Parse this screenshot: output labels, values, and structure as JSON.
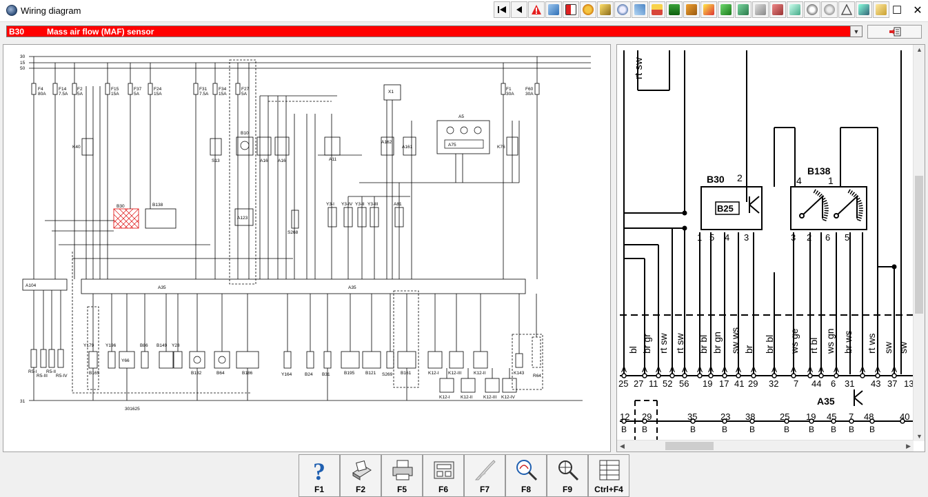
{
  "window": {
    "title": "Wiring diagram",
    "controls": [
      "☐",
      "✕"
    ]
  },
  "toolbar": {
    "icons": [
      "first-page-icon",
      "prev-page-icon",
      "warning-icon",
      "diagram-icon",
      "flag-icon",
      "gear-icon",
      "engine-icon",
      "clock-icon",
      "tools-icon",
      "battery-icon",
      "fuel-icon",
      "car-icon",
      "lamp-icon",
      "brake-icon",
      "circuit-icon",
      "info-icon",
      "settings-icon",
      "book-icon",
      "gauge-icon",
      "bulb-icon",
      "triangle-icon",
      "chip-icon",
      "note-icon"
    ]
  },
  "component_selector": {
    "code": "B30",
    "name": "Mass air flow (MAF) sensor"
  },
  "left_diagram": {
    "bus_labels": [
      "30",
      "15",
      "50",
      "31"
    ],
    "fuses": [
      "F4",
      "F14",
      "F2",
      "F15",
      "F37",
      "F24",
      "F31",
      "F34",
      "F27",
      "F1",
      "F60"
    ],
    "fuse_ratings": [
      "80A",
      "7.5A",
      "5A",
      "15A",
      "5A",
      "15A",
      "7.5A",
      "15A",
      "5A",
      "30A",
      "30A"
    ],
    "components_top": [
      "K40",
      "S13",
      "B10",
      "A16",
      "A16",
      "A11",
      "X1",
      "A162",
      "A161",
      "A5",
      "A75",
      "K76"
    ],
    "components_mid": [
      "B30",
      "B138",
      "A123",
      "S268",
      "Y3-I",
      "Y3-IV",
      "Y3-II",
      "Y3-III",
      "A81"
    ],
    "ecu_labels": [
      "A104",
      "A35",
      "A35"
    ],
    "components_bottom": [
      "R5-I",
      "R5-III",
      "R5-II",
      "R5-IV",
      "Y179",
      "B165",
      "Y196",
      "Y66",
      "B86",
      "B149",
      "Y28",
      "B132",
      "B64",
      "B186",
      "Y164",
      "B24",
      "B31",
      "B195",
      "B121",
      "S269",
      "B161",
      "K12-I",
      "K12-III",
      "K12-II",
      "K143",
      "R64"
    ],
    "relay_boxes": [
      "K12-I",
      "K12-II",
      "K12-III",
      "K12-IV"
    ],
    "drawing_number": "301625"
  },
  "right_diagram": {
    "wire_top": "rt sw",
    "b30": {
      "label": "B30",
      "inner": "B25",
      "pin_top": "2",
      "pins": [
        "1",
        "5",
        "4",
        "3"
      ]
    },
    "b138": {
      "label": "B138",
      "pin_top_left": "4",
      "pin_top_right": "1",
      "pins": [
        "3",
        "2",
        "6",
        "5"
      ]
    },
    "wire_colors": [
      "bl",
      "br gr",
      "rt sw",
      "rt sw",
      "br bl",
      "br gn",
      "sw ws",
      "br",
      "br bl",
      "ws ge",
      "rt bl",
      "ws gn",
      "br ws",
      "rt ws",
      "sw",
      "sw"
    ],
    "pin_letter": "A",
    "ecu_pins": [
      "25",
      "27",
      "11",
      "52",
      "56",
      "19",
      "17",
      "41",
      "29",
      "32",
      "7",
      "44",
      "6",
      "31",
      "43",
      "37",
      "13"
    ],
    "ecu_label": "A35",
    "lower_pins": [
      "12",
      "29",
      "35",
      "23",
      "38",
      "25",
      "19",
      "45",
      "7",
      "48",
      "40"
    ],
    "lower_letter": "B"
  },
  "function_keys": [
    {
      "label": "F1",
      "icon": "help-icon"
    },
    {
      "label": "F2",
      "icon": "print-preview-icon"
    },
    {
      "label": "F5",
      "icon": "printer-icon"
    },
    {
      "label": "F6",
      "icon": "connector-icon"
    },
    {
      "label": "F7",
      "icon": "probe-icon"
    },
    {
      "label": "F8",
      "icon": "zoom-icon"
    },
    {
      "label": "F9",
      "icon": "search-icon"
    },
    {
      "label": "Ctrl+F4",
      "icon": "list-icon"
    }
  ],
  "colors": {
    "selector_bg": "#ff0000",
    "selector_text": "#ffffff",
    "diagram_line": "#000000"
  }
}
